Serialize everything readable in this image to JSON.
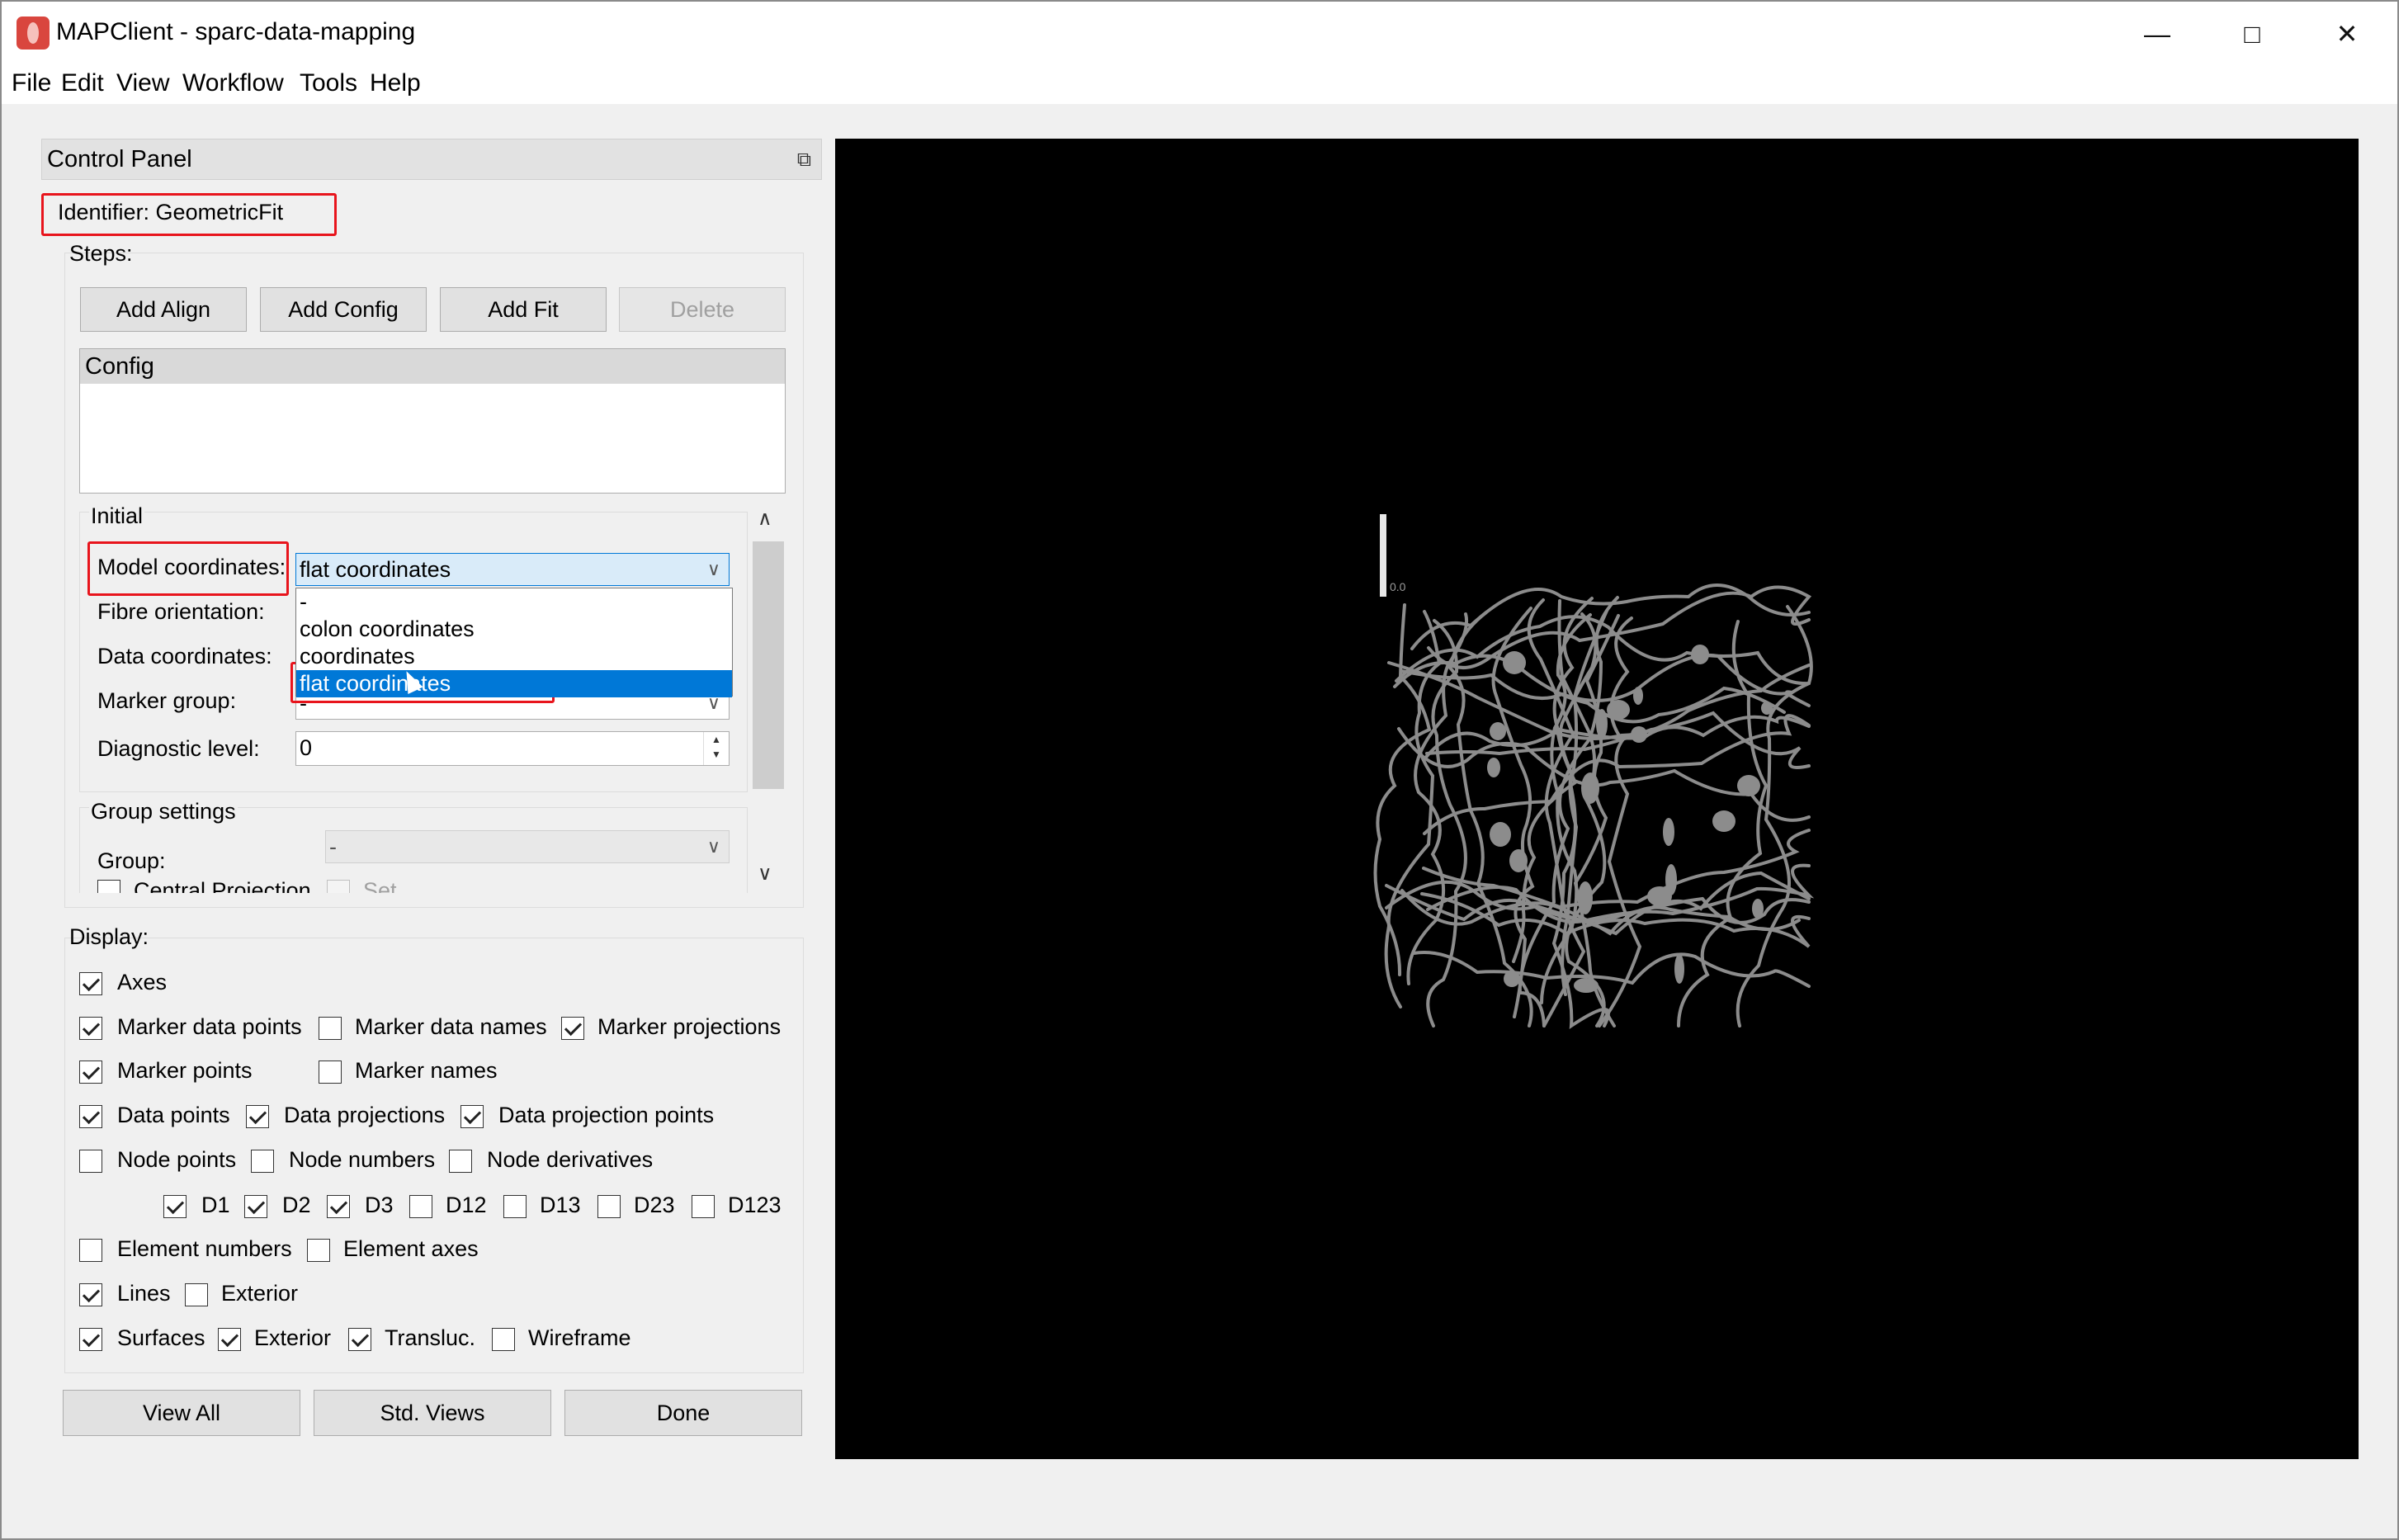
{
  "window": {
    "title": "MAPClient - sparc-data-mapping",
    "minimize_symbol": "—",
    "maximize_symbol": "□",
    "close_symbol": "✕"
  },
  "menu": [
    "File",
    "Edit",
    "View",
    "Workflow",
    "Tools",
    "Help"
  ],
  "control_panel": {
    "title": "Control Panel",
    "identifier": "Identifier:  GeometricFit",
    "steps_label": "Steps:",
    "step_buttons": [
      "Add Align",
      "Add Config",
      "Add Fit",
      "Delete"
    ],
    "steps_list_header": "Config",
    "initial": {
      "section_label": "Initial",
      "model_coordinates": {
        "label": "Model coordinates:",
        "value": "flat coordinates"
      },
      "fibre_orientation": {
        "label": "Fibre orientation:"
      },
      "data_coordinates": {
        "label": "Data coordinates:"
      },
      "marker_group": {
        "label": "Marker group:",
        "value": "-"
      },
      "diagnostic_level": {
        "label": "Diagnostic level:",
        "value": "0"
      },
      "dropdown_options": [
        "-",
        "colon coordinates",
        "coordinates",
        "flat coordinates"
      ],
      "dropdown_selected": "flat coordinates"
    },
    "group_settings": {
      "section_label": "Group settings",
      "group": {
        "label": "Group:",
        "value": "-"
      },
      "central_projection": {
        "label": "Central Projection",
        "checked": false
      },
      "set": {
        "label": "Set",
        "checked": false
      }
    },
    "display": {
      "label": "Display:",
      "axes": {
        "label": "Axes",
        "checked": true
      },
      "marker_data_points": {
        "label": "Marker data points",
        "checked": true
      },
      "marker_data_names": {
        "label": "Marker data names",
        "checked": false
      },
      "marker_projections": {
        "label": "Marker projections",
        "checked": true
      },
      "marker_points": {
        "label": "Marker points",
        "checked": true
      },
      "marker_names": {
        "label": "Marker names",
        "checked": false
      },
      "data_points": {
        "label": "Data points",
        "checked": true
      },
      "data_projections": {
        "label": "Data projections",
        "checked": true
      },
      "data_projection_points": {
        "label": "Data projection points",
        "checked": true
      },
      "node_points": {
        "label": "Node points",
        "checked": false
      },
      "node_numbers": {
        "label": "Node numbers",
        "checked": false
      },
      "node_derivatives": {
        "label": "Node derivatives",
        "checked": false
      },
      "d1": {
        "label": "D1",
        "checked": true
      },
      "d2": {
        "label": "D2",
        "checked": true
      },
      "d3": {
        "label": "D3",
        "checked": true
      },
      "d12": {
        "label": "D12",
        "checked": false
      },
      "d13": {
        "label": "D13",
        "checked": false
      },
      "d23": {
        "label": "D23",
        "checked": false
      },
      "d123": {
        "label": "D123",
        "checked": false
      },
      "element_numbers": {
        "label": "Element numbers",
        "checked": false
      },
      "element_axes": {
        "label": "Element axes",
        "checked": false
      },
      "lines": {
        "label": "Lines",
        "checked": true
      },
      "lines_exterior": {
        "label": "Exterior",
        "checked": false
      },
      "surfaces": {
        "label": "Surfaces",
        "checked": true
      },
      "surfaces_exterior": {
        "label": "Exterior",
        "checked": true
      },
      "transluc": {
        "label": "Transluc.",
        "checked": true
      },
      "wireframe": {
        "label": "Wireframe",
        "checked": false
      }
    },
    "bottom_buttons": [
      "View All",
      "Std. Views",
      "Done"
    ]
  },
  "viewer": {
    "axis_label": "0.0",
    "background": "#000000",
    "mesh_color": "#8c8c8c"
  },
  "colors": {
    "highlight": "#e8141c",
    "selection": "#0078d7"
  }
}
